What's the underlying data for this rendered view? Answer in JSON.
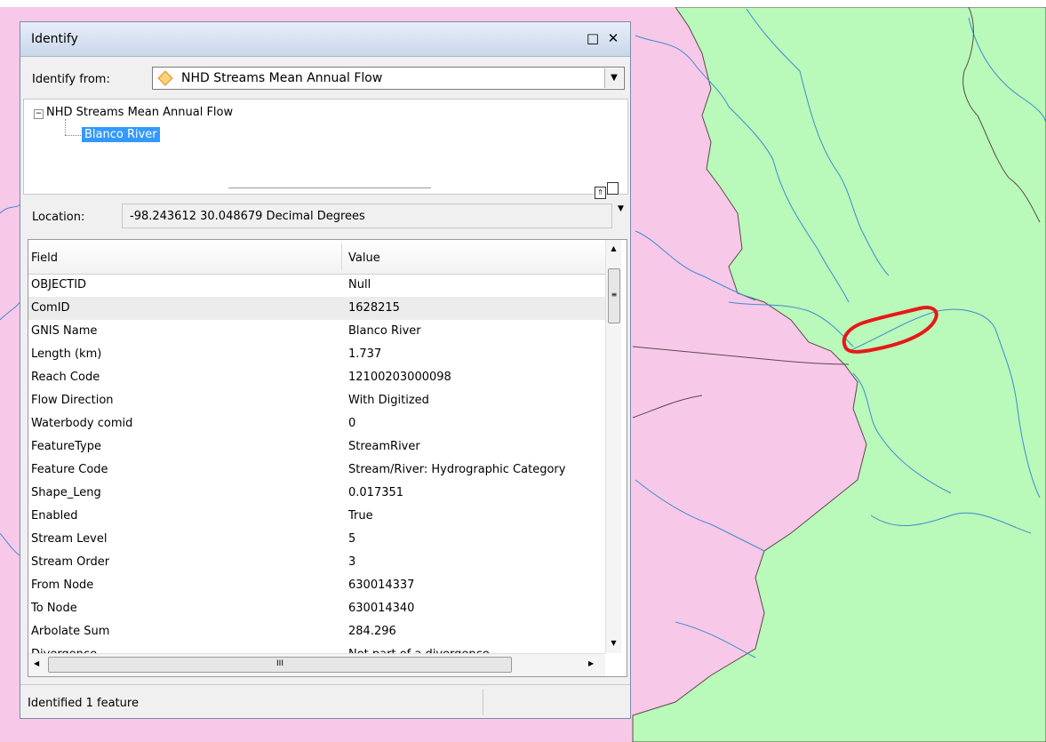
{
  "identify": {
    "title": "Identify",
    "maximize_icon": "□",
    "close_icon": "✕",
    "from_label": "Identify from:",
    "from_value": "NHD Streams Mean Annual Flow",
    "dropdown_arrow": "▼",
    "tree": {
      "layer": "NHD Streams Mean Annual Flow",
      "feature": "Blanco River",
      "expander": "−"
    },
    "location_label": "Location:",
    "location_value": "-98.243612  30.048679 Decimal Degrees",
    "columns": {
      "field": "Field",
      "value": "Value"
    },
    "rows": [
      {
        "field": "OBJECTID",
        "value": "Null"
      },
      {
        "field": "ComID",
        "value": "1628215"
      },
      {
        "field": "GNIS Name",
        "value": "Blanco River"
      },
      {
        "field": "Length (km)",
        "value": "1.737"
      },
      {
        "field": "Reach Code",
        "value": "12100203000098"
      },
      {
        "field": "Flow Direction",
        "value": "With Digitized"
      },
      {
        "field": "Waterbody comid",
        "value": "0"
      },
      {
        "field": "FeatureType",
        "value": "StreamRiver"
      },
      {
        "field": "Feature Code",
        "value": "Stream/River: Hydrographic Category"
      },
      {
        "field": "Shape_Leng",
        "value": "0.017351"
      },
      {
        "field": "Enabled",
        "value": "True"
      },
      {
        "field": "Stream Level",
        "value": "5"
      },
      {
        "field": "Stream Order",
        "value": "3"
      },
      {
        "field": "From Node",
        "value": "630014337"
      },
      {
        "field": "To Node",
        "value": "630014340"
      },
      {
        "field": "Arbolate Sum",
        "value": "284.296"
      },
      {
        "field": "Divergence",
        "value": "Not part of a divergence"
      }
    ],
    "status": "Identified 1 feature"
  },
  "colors": {
    "pink_region": "#f8c8e8",
    "green_region": "#b9f9b9",
    "stream": "#3c8cd2",
    "highlight": "#e81818"
  }
}
